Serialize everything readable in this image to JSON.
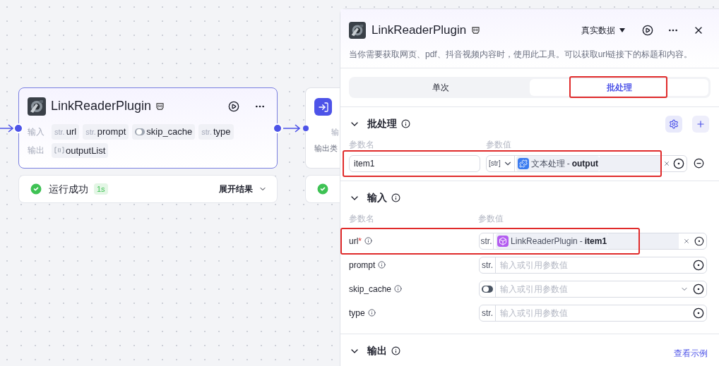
{
  "canvas": {
    "nodes": [
      {
        "title": "LinkReaderPlugin",
        "inputs_label": "输入",
        "inputs": [
          {
            "kind": "text",
            "type": "str.",
            "name": "url"
          },
          {
            "kind": "text",
            "type": "str.",
            "name": "prompt"
          },
          {
            "kind": "boolean",
            "name": "skip_cache"
          },
          {
            "kind": "text",
            "type": "str.",
            "name": "type"
          }
        ],
        "outputs_label": "输出",
        "outputs": [
          {
            "kind": "array",
            "name": "outputList"
          }
        ],
        "status": {
          "text": "运行成功",
          "time": "1s",
          "action": "展开结果"
        }
      },
      {
        "inputs_label": "输",
        "outputs_label": "输出类"
      }
    ]
  },
  "panel": {
    "title": "LinkReaderPlugin",
    "data_mode": "真实数据",
    "description": "当你需要获取网页、pdf、抖音视频内容时，使用此工具。可以获取url链接下的标题和内容。",
    "tabs": [
      {
        "label": "单次",
        "selected": false,
        "highlighted": false
      },
      {
        "label": "批处理",
        "selected": true,
        "highlighted": true
      }
    ],
    "batch": {
      "title": "批处理",
      "expanded": true,
      "name_header": "参数名",
      "value_header": "参数值",
      "rows": [
        {
          "name": "item1",
          "type": "[str]",
          "ref_node": "文本处理",
          "separator": "-",
          "ref_field": "output",
          "highlighted": true
        }
      ]
    },
    "inputs": {
      "title": "输入",
      "expanded": true,
      "name_header": "参数名",
      "value_header": "参数值",
      "params": [
        {
          "name": "url",
          "required_mark": "*",
          "kind": "text",
          "type": "str.",
          "ref_node": "LinkReaderPlugin",
          "separator": "-",
          "ref_field": "item1",
          "highlighted": true
        },
        {
          "name": "prompt",
          "kind": "text",
          "type": "str.",
          "placeholder": "输入或引用参数值",
          "highlighted": false
        },
        {
          "name": "skip_cache",
          "kind": "boolean",
          "placeholder": "输入或引用参数值",
          "highlighted": false
        },
        {
          "name": "type",
          "kind": "text",
          "type": "str.",
          "placeholder": "输入或引用参数值",
          "highlighted": false
        }
      ]
    },
    "outputs": {
      "title": "输出",
      "expanded": true,
      "link": "查看示例"
    }
  }
}
